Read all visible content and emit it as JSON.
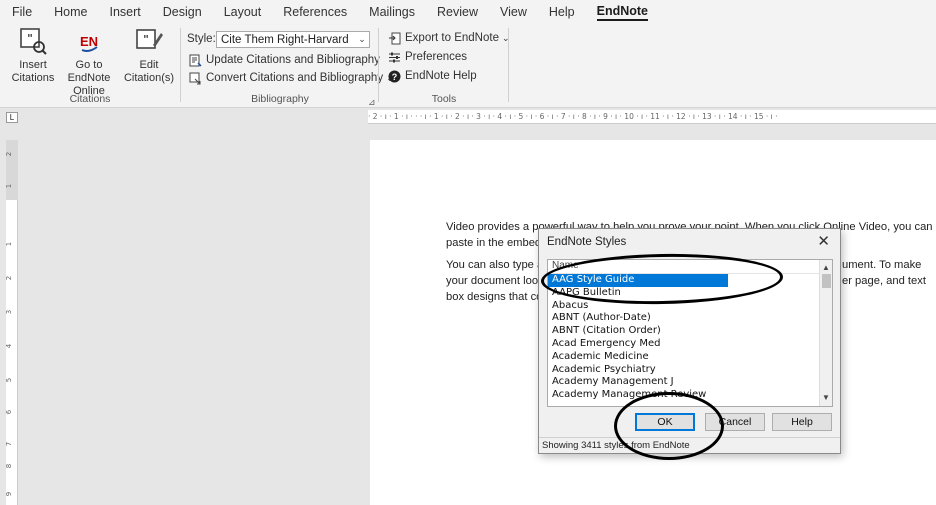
{
  "ribbon_tabs": [
    "File",
    "Home",
    "Insert",
    "Design",
    "Layout",
    "References",
    "Mailings",
    "Review",
    "View",
    "Help",
    "EndNote"
  ],
  "ribbon": {
    "citations_group": {
      "label": "Citations",
      "insert_label": "Insert Citations",
      "goto_label": "Go to EndNote Online",
      "edit_label": "Edit Citation(s)",
      "en_logo": "EN"
    },
    "bibliography_group": {
      "label": "Bibliography",
      "style_label": "Style:",
      "style_value": "Cite Them Right-Harvard",
      "update_label": "Update Citations and Bibliography",
      "convert_label": "Convert Citations and Bibliography"
    },
    "tools_group": {
      "label": "Tools",
      "export_label": "Export to EndNote",
      "preferences_label": "Preferences",
      "help_label": "EndNote Help"
    }
  },
  "ruler": {
    "horizontal_text": "· 2 · ı · 1 · ı · ·  · ı · 1 · ı · 2 · ı · 3 · ı · 4 · ı · 5 · ı · 6 · ı · 7 · ı · 8 · ı · 9 · ı · 10 · ı · 11 · ı · 12 · ı · 13 · ı · 14 · ı · 15 · ı ·",
    "tab_selector": "L",
    "vertical_labels": [
      "2",
      "1",
      "1",
      "2",
      "3",
      "4",
      "5",
      "6",
      "7",
      "8",
      "9"
    ]
  },
  "document": {
    "paragraph1_line1": "Video provides a powerful way to help you prove your point. When you click Online Video, you can",
    "paragraph1_line2": "paste in the embed",
    "paragraph2_line1": "You can also type a",
    "paragraph2_line1_end": "ument. To make",
    "paragraph2_line2": "your document loo",
    "paragraph2_line2_end": "er page, and text",
    "paragraph2_line3": "box designs that co"
  },
  "dialog": {
    "title": "EndNote Styles",
    "close_glyph": "✕",
    "list_header": "Name",
    "items": [
      "AAG Style Guide",
      "AAPG Bulletin",
      "Abacus",
      "ABNT (Author-Date)",
      "ABNT (Citation Order)",
      "Acad Emergency Med",
      "Academic Medicine",
      "Academic Psychiatry",
      "Academy Management J",
      "Academy Management Review"
    ],
    "selected_index": 0,
    "ok_label": "OK",
    "cancel_label": "Cancel",
    "help_label": "Help",
    "status": "Showing 3411 styles from EndNote"
  },
  "colors": {
    "accent": "#0078d7",
    "endnote_red": "#c00000",
    "endnote_blue": "#1f4fa0"
  }
}
